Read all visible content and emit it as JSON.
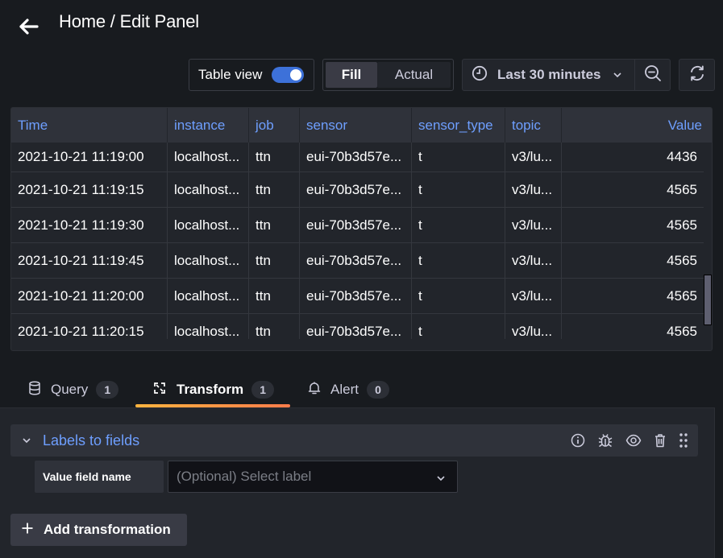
{
  "header": {
    "title": "Home / Edit Panel"
  },
  "toolbar": {
    "table_view_label": "Table view",
    "table_view_enabled": true,
    "fill_label": "Fill",
    "actual_label": "Actual",
    "time_range_label": "Last 30 minutes"
  },
  "table": {
    "columns": [
      "Time",
      "instance",
      "job",
      "sensor",
      "sensor_type",
      "topic",
      "Value"
    ],
    "rows": [
      [
        "2021-10-21 11:19:00",
        "localhost...",
        "ttn",
        "eui-70b3d57e...",
        "t",
        "v3/lu...",
        "4436"
      ],
      [
        "2021-10-21 11:19:15",
        "localhost...",
        "ttn",
        "eui-70b3d57e...",
        "t",
        "v3/lu...",
        "4565"
      ],
      [
        "2021-10-21 11:19:30",
        "localhost...",
        "ttn",
        "eui-70b3d57e...",
        "t",
        "v3/lu...",
        "4565"
      ],
      [
        "2021-10-21 11:19:45",
        "localhost...",
        "ttn",
        "eui-70b3d57e...",
        "t",
        "v3/lu...",
        "4565"
      ],
      [
        "2021-10-21 11:20:00",
        "localhost...",
        "ttn",
        "eui-70b3d57e...",
        "t",
        "v3/lu...",
        "4565"
      ],
      [
        "2021-10-21 11:20:15",
        "localhost...",
        "ttn",
        "eui-70b3d57e...",
        "t",
        "v3/lu...",
        "4565"
      ]
    ]
  },
  "tabs": [
    {
      "label": "Query",
      "count": "1",
      "icon": "database-icon",
      "active": false
    },
    {
      "label": "Transform",
      "count": "1",
      "icon": "transform-icon",
      "active": true
    },
    {
      "label": "Alert",
      "count": "0",
      "icon": "bell-icon",
      "active": false
    }
  ],
  "transform": {
    "title": "Labels to fields",
    "field_label": "Value field name",
    "select_placeholder": "(Optional) Select label",
    "add_button_label": "Add transformation"
  },
  "colors": {
    "accent_blue": "#6e9fff",
    "toggle_on": "#3d71d9",
    "tab_gradient_start": "#ffb43f",
    "tab_gradient_end": "#ff7c4b",
    "background": "#181b1f",
    "panel": "#22252b"
  }
}
